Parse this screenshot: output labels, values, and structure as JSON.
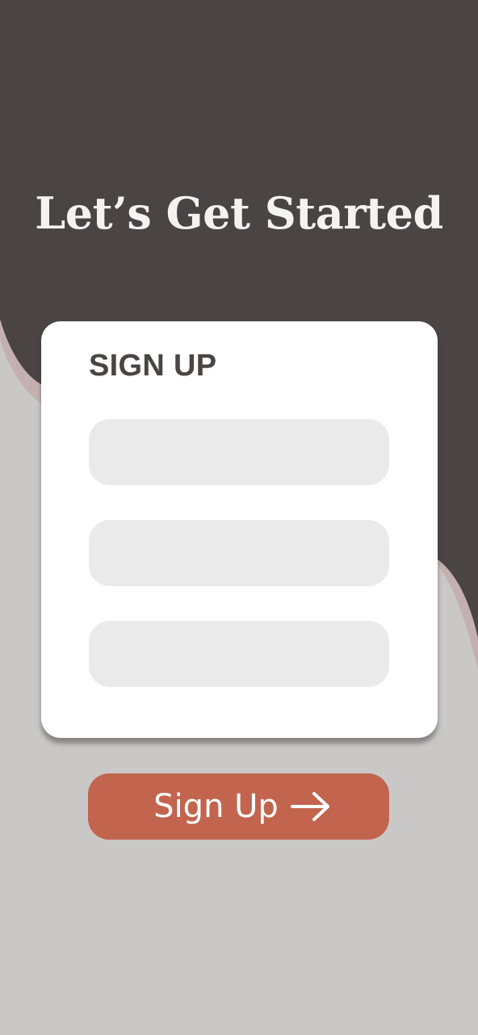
{
  "header": {
    "title": "Let’s Get Started"
  },
  "form": {
    "heading": "SIGN UP",
    "fields": [
      {
        "value": "",
        "placeholder": ""
      },
      {
        "value": "",
        "placeholder": ""
      },
      {
        "value": "",
        "placeholder": ""
      }
    ],
    "submit_label": "Sign Up",
    "submit_icon": "arrow-right-icon"
  },
  "colors": {
    "header_background": "#4a4444",
    "page_background": "#c9c8c6",
    "wave_accent": "#c4b0b0",
    "card_background": "#ffffff",
    "field_background": "#eaeaea",
    "button_background": "#c2644e",
    "title_text": "#f5f3f0",
    "heading_text": "#4a4444"
  }
}
